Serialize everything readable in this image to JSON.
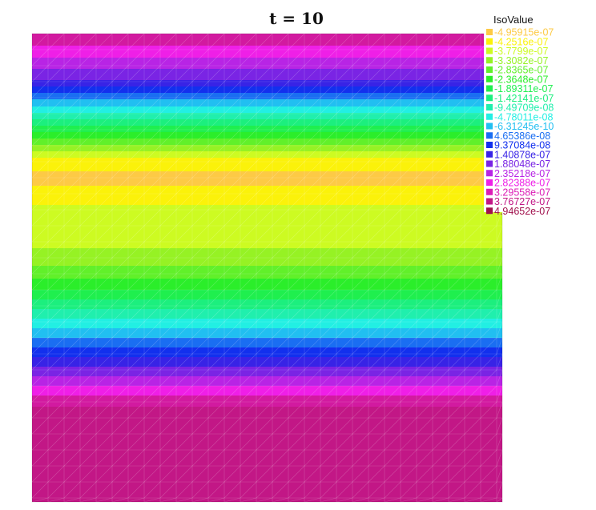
{
  "chart_data": {
    "type": "heatmap",
    "title": "t = 10",
    "legend": {
      "heading": "IsoValue",
      "position": "top-right",
      "entries": [
        {
          "label": "-4.95915e-07",
          "color": "#fdca45"
        },
        {
          "label": "-4.2516e-07",
          "color": "#fbf20a"
        },
        {
          "label": "-3.7799e-07",
          "color": "#cdfb22"
        },
        {
          "label": "-3.3082e-07",
          "color": "#96f224"
        },
        {
          "label": "-2.8365e-07",
          "color": "#61f02a"
        },
        {
          "label": "-2.3648e-07",
          "color": "#2bee2a"
        },
        {
          "label": "-1.89311e-07",
          "color": "#1fef4e"
        },
        {
          "label": "-1.42141e-07",
          "color": "#1cef7e"
        },
        {
          "label": "-9.49709e-08",
          "color": "#20efad"
        },
        {
          "label": "-4.78011e-08",
          "color": "#22efe3"
        },
        {
          "label": "-6.31245e-10",
          "color": "#21bff1"
        },
        {
          "label": "4.65386e-08",
          "color": "#1a6ef2"
        },
        {
          "label": "9.37084e-08",
          "color": "#1230ee"
        },
        {
          "label": "1.40878e-07",
          "color": "#3823e6"
        },
        {
          "label": "1.88048e-07",
          "color": "#7a24e4"
        },
        {
          "label": "2.35218e-07",
          "color": "#b824e5"
        },
        {
          "label": "2.82388e-07",
          "color": "#ef1fe7"
        },
        {
          "label": "3.29558e-07",
          "color": "#dc1cb6"
        },
        {
          "label": "3.76727e-07",
          "color": "#c21786"
        },
        {
          "label": "4.94652e-07",
          "color": "#a0104c"
        }
      ]
    },
    "bands_top_to_bottom": [
      {
        "level": 17,
        "color": "#d21aa0"
      },
      {
        "level": 16,
        "color": "#ef1fe7"
      },
      {
        "level": 15,
        "color": "#b824e5"
      },
      {
        "level": 14,
        "color": "#7a24e4"
      },
      {
        "level": 13,
        "color": "#3823e6"
      },
      {
        "level": 12,
        "color": "#1230ee"
      },
      {
        "level": 11,
        "color": "#1a6ef2"
      },
      {
        "level": 10,
        "color": "#21bff1"
      },
      {
        "level": 9,
        "color": "#22efe3"
      },
      {
        "level": 8,
        "color": "#20efad"
      },
      {
        "level": 7,
        "color": "#1cef7e"
      },
      {
        "level": 6,
        "color": "#1fef4e"
      },
      {
        "level": 5,
        "color": "#2bee2a"
      },
      {
        "level": 4,
        "color": "#61f02a"
      },
      {
        "level": 3,
        "color": "#96f224"
      },
      {
        "level": 2,
        "color": "#cdfb22"
      },
      {
        "level": 1,
        "color": "#fbf20a"
      },
      {
        "level": 0,
        "color": "#fdca45"
      },
      {
        "level": 1,
        "color": "#fbf20a"
      },
      {
        "level": 2,
        "color": "#cdfb22"
      },
      {
        "level": 3,
        "color": "#96f224"
      },
      {
        "level": 4,
        "color": "#61f02a"
      },
      {
        "level": 5,
        "color": "#2bee2a"
      },
      {
        "level": 6,
        "color": "#1fef4e"
      },
      {
        "level": 7,
        "color": "#1cef7e"
      },
      {
        "level": 8,
        "color": "#20efad"
      },
      {
        "level": 9,
        "color": "#22efe3"
      },
      {
        "level": 10,
        "color": "#21bff1"
      },
      {
        "level": 11,
        "color": "#1a6ef2"
      },
      {
        "level": 12,
        "color": "#1230ee"
      },
      {
        "level": 13,
        "color": "#3823e6"
      },
      {
        "level": 14,
        "color": "#7a24e4"
      },
      {
        "level": 15,
        "color": "#b824e5"
      },
      {
        "level": 16,
        "color": "#ef1fe7"
      },
      {
        "level": 17,
        "color": "#d21aa0"
      },
      {
        "level": 18,
        "color": "#c21786"
      }
    ],
    "mesh_grid": true
  }
}
